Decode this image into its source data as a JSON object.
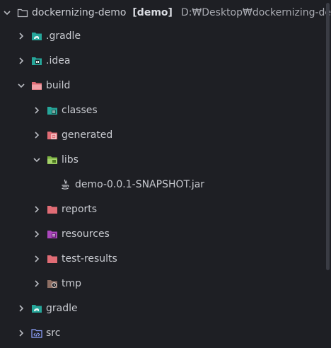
{
  "tree": {
    "root": {
      "label": "dockernizing-demo",
      "module": "[demo]",
      "path": "D:₩Desktop₩dockernizing-demo"
    },
    "gradle_hidden": ".gradle",
    "idea": ".idea",
    "build": "build",
    "classes": "classes",
    "generated": "generated",
    "libs": "libs",
    "jar": "demo-0.0.1-SNAPSHOT.jar",
    "reports": "reports",
    "resources": "resources",
    "test_results": "test-results",
    "tmp": "tmp",
    "gradle": "gradle",
    "src": "src"
  },
  "colors": {
    "background": "#1e1f24",
    "text": "#c9cbd1",
    "teal": "#26a69a",
    "folder_red": "#e06c75",
    "folder_green": "#7cb342",
    "folder_purple": "#ab47bc",
    "folder_brown": "#8d6e63",
    "folder_blue": "#5c7cfa"
  }
}
